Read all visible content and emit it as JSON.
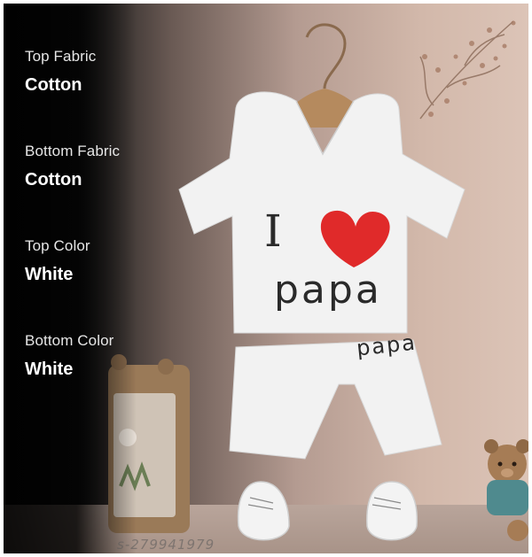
{
  "specs": [
    {
      "label": "Top Fabric",
      "value": "Cotton"
    },
    {
      "label": "Bottom Fabric",
      "value": "Cotton"
    },
    {
      "label": "Top Color",
      "value": "White"
    },
    {
      "label": "Bottom Color",
      "value": "White"
    }
  ],
  "product": {
    "shirt_text_i": "I",
    "shirt_text_papa": "papa",
    "shorts_text": "papa"
  },
  "watermark": "s-279941979",
  "colors": {
    "heart": "#e02a2a",
    "garment": "#f4f4f4"
  }
}
